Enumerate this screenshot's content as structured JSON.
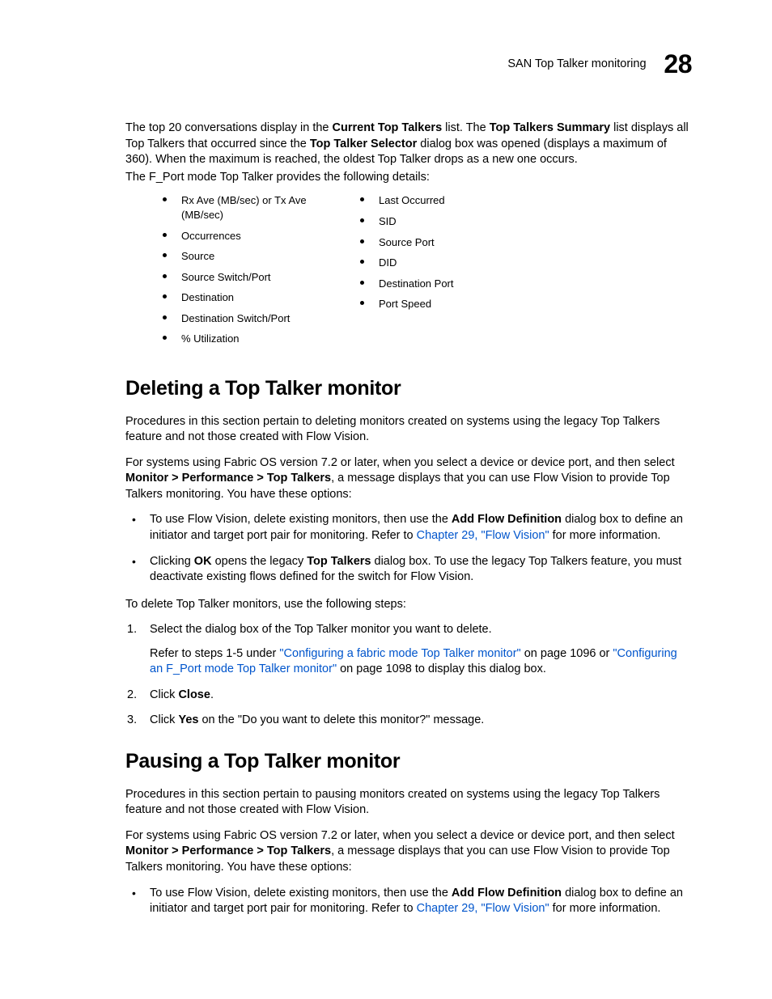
{
  "header": {
    "section_title": "SAN Top Talker monitoring",
    "chapter_number": "28"
  },
  "intro": {
    "p1_pre": "The top 20 conversations display in the ",
    "p1_b1": "Current Top Talkers",
    "p1_mid1": " list. The ",
    "p1_b2": "Top Talkers Summary",
    "p1_mid2": " list displays all Top Talkers that occurred since the ",
    "p1_b3": "Top Talker Selector",
    "p1_post": " dialog box was opened (displays a maximum of 360). When the maximum is reached, the oldest Top Talker drops as a new one occurs.",
    "p2": "The F_Port mode Top Talker provides the following details:"
  },
  "details_left": [
    "Rx Ave (MB/sec) or Tx Ave (MB/sec)",
    "Occurrences",
    "Source",
    "Source Switch/Port",
    "Destination",
    "Destination Switch/Port",
    "% Utilization"
  ],
  "details_right": [
    "Last Occurred",
    "SID",
    "Source Port",
    "DID",
    "Destination Port",
    "Port Speed"
  ],
  "deleting": {
    "heading": "Deleting a Top Talker monitor",
    "p1": "Procedures in this section pertain to deleting monitors created on systems using the legacy Top Talkers feature and not those created with Flow Vision.",
    "p2_pre": "For systems using Fabric OS version 7.2 or later, when you select a device or device port, and then select ",
    "p2_b": "Monitor > Performance > Top Talkers",
    "p2_post": ", a message displays that you can use Flow Vision to provide Top Talkers monitoring. You have these options:",
    "bul1_pre": "To use Flow Vision, delete existing monitors, then use the ",
    "bul1_b": "Add Flow Definition",
    "bul1_mid": " dialog box to define an initiator and target port pair for monitoring. Refer to ",
    "bul1_link": "Chapter 29, \"Flow Vision\"",
    "bul1_post": " for more information.",
    "bul2_pre": "Clicking ",
    "bul2_b1": "OK",
    "bul2_mid1": " opens the legacy ",
    "bul2_b2": "Top Talkers",
    "bul2_post": " dialog box. To use the legacy Top Talkers feature, you must deactivate existing flows defined for the switch for Flow Vision.",
    "p3": "To delete Top Talker monitors, use the following steps:",
    "step1": "Select the dialog box of the Top Talker monitor you want to delete.",
    "step1_sub_pre": "Refer to steps 1-5 under ",
    "step1_sub_link1": "\"Configuring a fabric mode Top Talker monitor\"",
    "step1_sub_mid1": " on page 1096 or ",
    "step1_sub_link2": "\"Configuring an F_Port mode Top Talker monitor\"",
    "step1_sub_post": " on page 1098 to display this dialog box.",
    "step2_pre": "Click ",
    "step2_b": "Close",
    "step2_post": ".",
    "step3_pre": "Click ",
    "step3_b": "Yes",
    "step3_post": " on the \"Do you want to delete this monitor?\" message."
  },
  "pausing": {
    "heading": "Pausing a Top Talker monitor",
    "p1": "Procedures in this section pertain to pausing monitors created on systems using the legacy Top Talkers feature and not those created with Flow Vision.",
    "p2_pre": "For systems using Fabric OS version 7.2 or later, when you select a device or device port, and then select ",
    "p2_b": "Monitor > Performance > Top Talkers",
    "p2_post": ", a message displays that you can use Flow Vision to provide Top Talkers monitoring. You have these options:",
    "bul1_pre": "To use Flow Vision, delete existing monitors, then use the ",
    "bul1_b": "Add Flow Definition",
    "bul1_mid": " dialog box to define an initiator and target port pair for monitoring. Refer to ",
    "bul1_link": "Chapter 29, \"Flow Vision\"",
    "bul1_post": " for more information."
  }
}
